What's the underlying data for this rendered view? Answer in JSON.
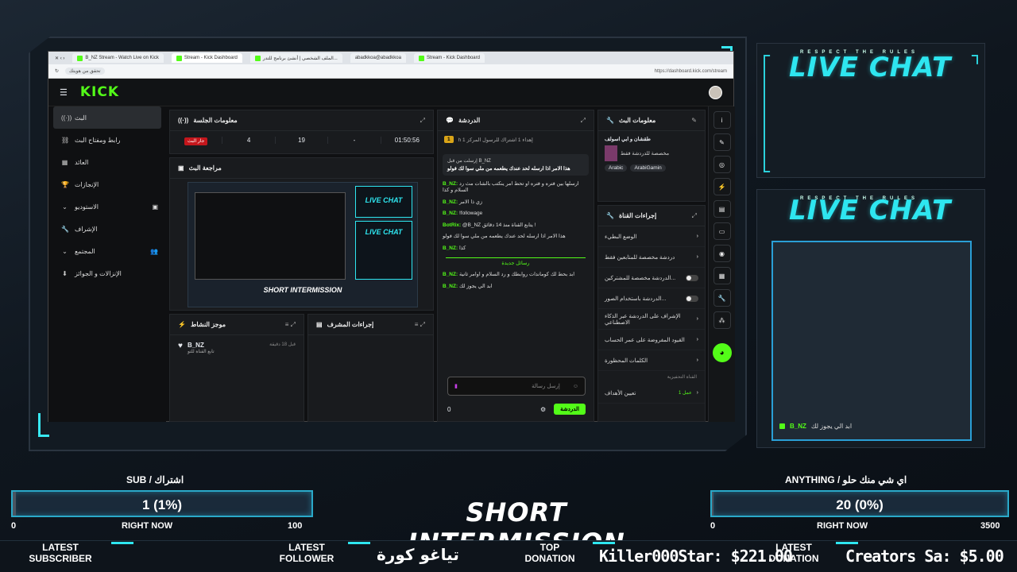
{
  "browser": {
    "tabs": [
      "B_NZ Stream - Watch Live on Kick",
      "Stream - Kick Dashboard",
      "الملف الشخصي | أنشئ برنامج للتدر...",
      "abadkkoa@abadkkoa",
      "Stream - Kick Dashboard"
    ],
    "url": "https://dashboard.kick.com/stream",
    "search_hint": "تحقق من هويتك"
  },
  "kick": {
    "logo": "KICK",
    "sidebar": [
      "البث",
      "رابط ومفتاح البث",
      "العائد",
      "الإنجازات",
      "الاستوديو",
      "الإشراف",
      "المجتمع",
      "الإنزالات و الجوائز"
    ],
    "session": {
      "title": "معلومات الجلسة",
      "live": "جار البث",
      "stats": [
        "4",
        "19",
        "-",
        "01:50:56"
      ]
    },
    "preview_title": "مراجعة البث",
    "activity": {
      "title": "موجز النشاط",
      "user": "B_NZ",
      "desc": "تابع القناة للتو",
      "time": "قبل 18 دقيقة"
    },
    "mod_title": "إجراءات المشرف",
    "chat": {
      "title": "الدردشة",
      "pinned_meta": "إرسلت من قبل B_NZ",
      "pinned_msg": "هذا الامر اذا ارسله لحد عندك يطعمه من ملي سوا لك فولو",
      "top_note": "h إهداء 1 اشتراك للرسول المركز 1",
      "lines": [
        {
          "user": "B_NZ:",
          "text": "ارسلها بين فتره و فتره او تحط امر ينكتب بالشات مث رد السلام و كذا"
        },
        {
          "user": "B_NZ:",
          "text": "زي ذا الامر"
        },
        {
          "user": "B_NZ:",
          "text": "!followage"
        },
        {
          "user": "BotRix:",
          "text": "@B_NZ يتابع القناة منذ 14 دقائق !"
        },
        {
          "user": "",
          "text": "هذا الامر اذا ارسله لحد عندك يطعمه من ملي سوا لك فولو"
        },
        {
          "user": "B_NZ:",
          "text": "كذا"
        }
      ],
      "new_messages": "رسائل جديدة",
      "lines2": [
        {
          "user": "B_NZ:",
          "text": "ابد بحط لك كوماندات روابطك و رد السلام و اوامر ثانية"
        },
        {
          "user": "B_NZ:",
          "text": "ابد الي يجوز لك"
        }
      ],
      "input_placeholder": "إرسل رسالة",
      "send": "الدردشة",
      "count": "0"
    },
    "stream_info": {
      "title": "معلومات البث",
      "name": "طقشان و ابي اسولف",
      "desc": "مخصصة للدردشة فقط",
      "tags": [
        "Arabic",
        "ArabiGamin"
      ]
    },
    "channel": {
      "title": "إجراءات القناة",
      "rows": [
        "الوضع البطيء",
        "دردشة مخصصة للمتابعين فقط",
        "الدردشة مخصصة للمشتركين...",
        "الدردشة باستخدام الصور...",
        "الإشراف على الدردشة عبر الذكاء الاصطناعي",
        "القيود المفروضة على عمر الحساب",
        "الكلمات المحظورة"
      ],
      "sub_label": "القناة التحفيزية",
      "goal": "تعيين الأهداف",
      "goal_val": "عمل 1"
    }
  },
  "overlay": {
    "respect": "RESPECT THE RULES",
    "live_chat": "LIVE CHAT",
    "chat_user": "B_NZ",
    "chat_msg": "ابد الي يجوز لك",
    "sub_label": "SUB / اشتراك",
    "sub_value": "1 (1%)",
    "sub_progress": 0.01,
    "sub_min": "0",
    "sub_max": "100",
    "right_now": "RIGHT NOW",
    "anything_label": "ANYTHING / اي شي منك حلو",
    "anything_value": "20 (0%)",
    "anything_progress": 0.0057,
    "anything_min": "0",
    "anything_max": "3500",
    "title": "SHORT INTERMISSION",
    "latest_sub": "LATEST\nSUBSCRIBER",
    "latest_follower_label": "LATEST\nFOLLOWER",
    "latest_follower": "تياغو كورة",
    "top_donation_label": "TOP\nDONATION",
    "top_donation": "Killer000Star: $221.00",
    "latest_donation_label": "LATEST\nDONATION",
    "latest_donation": "Creators Sa: $5.00"
  }
}
